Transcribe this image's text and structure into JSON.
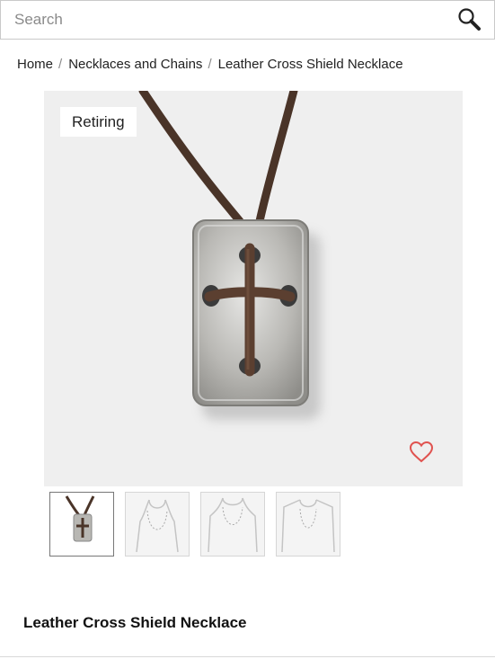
{
  "search": {
    "placeholder": "Search",
    "value": ""
  },
  "breadcrumb": {
    "items": [
      "Home",
      "Necklaces and Chains",
      "Leather Cross Shield Necklace"
    ],
    "separator": "/"
  },
  "product": {
    "badge": "Retiring",
    "title": "Leather Cross Shield Necklace",
    "thumbnail_count": 4,
    "selected_thumbnail": 1
  },
  "colors": {
    "favorite_heart": "#e0524f",
    "image_background": "#efefef"
  },
  "icons": {
    "search": "search-icon",
    "favorite": "heart-outline-icon"
  }
}
